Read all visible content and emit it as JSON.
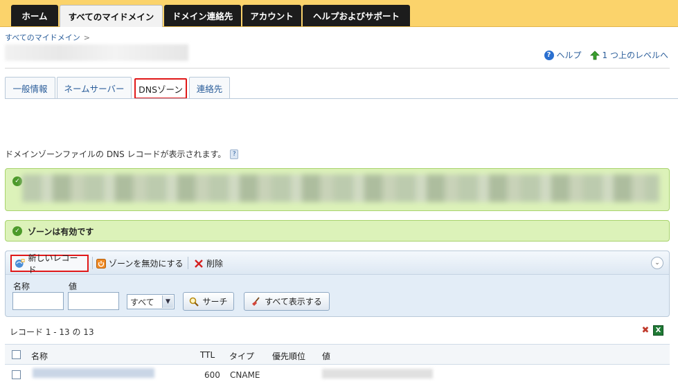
{
  "nav": {
    "tabs": [
      {
        "label": "ホーム"
      },
      {
        "label": "すべてのマイドメイン"
      },
      {
        "label": "ドメイン連絡先"
      },
      {
        "label": "アカウント"
      },
      {
        "label": "ヘルプおよびサポート"
      }
    ]
  },
  "breadcrumb": {
    "root": "すべてのマイドメイン",
    "sep": ">"
  },
  "header_links": {
    "help": "ヘルプ",
    "up": "1 つ上のレベルへ"
  },
  "subtabs": [
    {
      "label": "一般情報"
    },
    {
      "label": "ネームサーバー"
    },
    {
      "label": "DNSゾーン"
    },
    {
      "label": "連絡先"
    }
  ],
  "description": "ドメインゾーンファイルの DNS レコードが表示されます。",
  "zone_status": "ゾーンは有効です",
  "toolbar": {
    "new_record": "新しいレコード",
    "disable_zone": "ゾーンを無効にする",
    "delete": "削除"
  },
  "filter": {
    "name_label": "名称",
    "value_label": "値",
    "name_value": "",
    "value_value": "",
    "type_selected": "すべて",
    "search_button": "サーチ",
    "show_all_button": "すべて表示する"
  },
  "records": {
    "count_text": "レコード 1 - 13 の 13"
  },
  "table": {
    "headers": {
      "name": "名称",
      "ttl": "TTL",
      "type": "タイプ",
      "priority": "優先順位",
      "value": "値"
    },
    "rows": [
      {
        "ttl": "600",
        "type": "CNAME"
      }
    ]
  },
  "colors": {
    "nav_bg": "#fbd36b",
    "nav_tab": "#1c1c1c",
    "success_bg": "#dcf2b9",
    "highlight": "#e01818",
    "link": "#2a5d9a"
  }
}
